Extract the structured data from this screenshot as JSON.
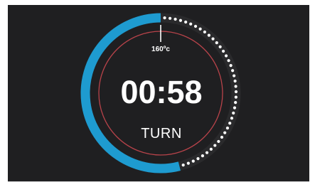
{
  "display": {
    "temperature": "160ºc",
    "timer": "00:58",
    "status": "TURN"
  },
  "progress_ring": {
    "elapsed_fraction": 0.54,
    "remaining_dot_count": 40
  },
  "colors": {
    "background": "#1f1f21",
    "progress_arc": "#1e9bd0",
    "inner_ring": "#b8434a",
    "text": "#ffffff",
    "dots": "#ffffff",
    "marker": "#ffffff"
  }
}
